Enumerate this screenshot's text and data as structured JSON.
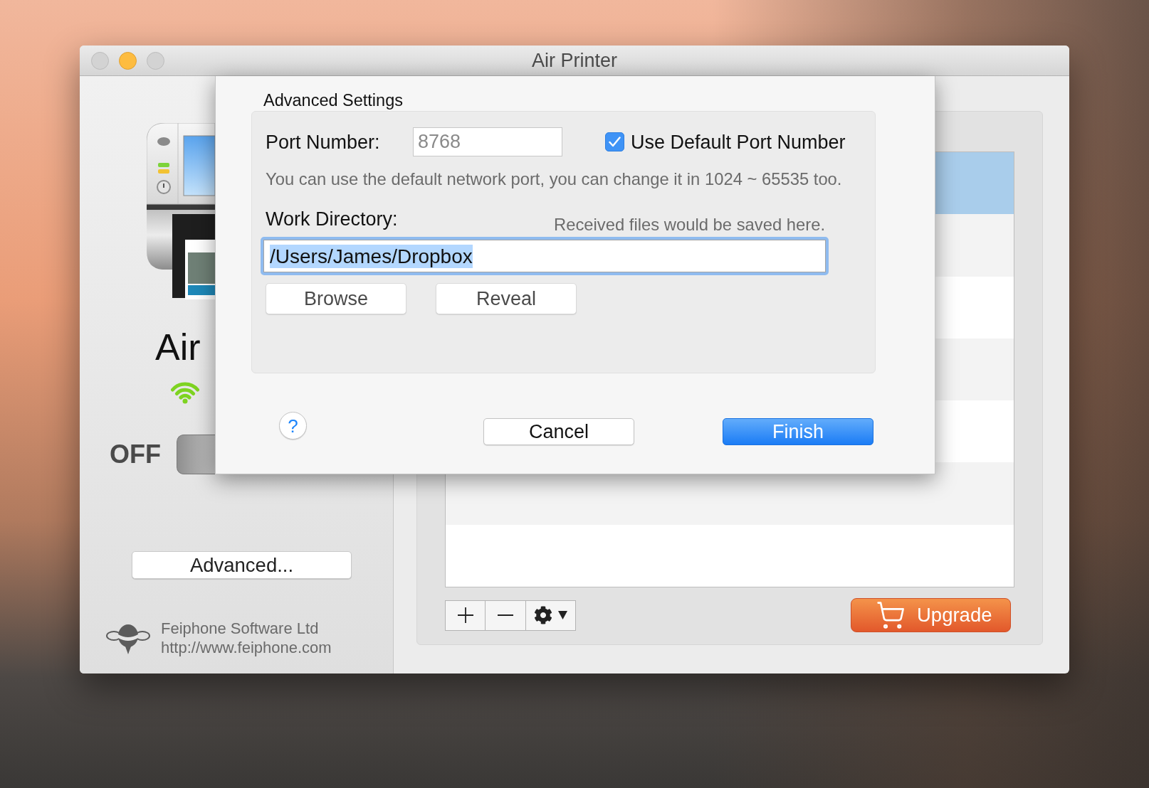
{
  "window": {
    "title": "Air Printer",
    "controls": [
      {
        "kind": "close",
        "enabled": false
      },
      {
        "kind": "minimize",
        "enabled": true
      },
      {
        "kind": "zoom",
        "enabled": false
      }
    ]
  },
  "sidebar": {
    "app_name": "Air",
    "power": {
      "label": "OFF",
      "on": false
    },
    "advanced_button": "Advanced...",
    "company": "Feiphone Software Ltd",
    "website": "http://www.feiphone.com"
  },
  "device_list": {
    "rows": [
      {
        "selected": true
      },
      {
        "selected": false
      },
      {
        "selected": false
      },
      {
        "selected": false
      },
      {
        "selected": false
      },
      {
        "selected": false
      },
      {
        "selected": false
      }
    ]
  },
  "upgrade_button": "Upgrade",
  "dialog": {
    "title": "Advanced Settings",
    "port": {
      "label": "Port Number:",
      "value": "8768",
      "disabled": true
    },
    "use_default_port": {
      "label": "Use Default Port Number",
      "checked": true
    },
    "port_hint": "You can use the default network port, you can change it in 1024 ~ 65535 too.",
    "work_directory": {
      "label": "Work Directory:",
      "hint": "Received files would be saved here.",
      "value": "/Users/James/Dropbox",
      "focused": true
    },
    "directory_buttons": [
      "Browse",
      "Reveal"
    ],
    "help_button": "?",
    "buttons": [
      {
        "label": "Cancel",
        "default": false
      },
      {
        "label": "Finish",
        "default": true
      }
    ]
  }
}
